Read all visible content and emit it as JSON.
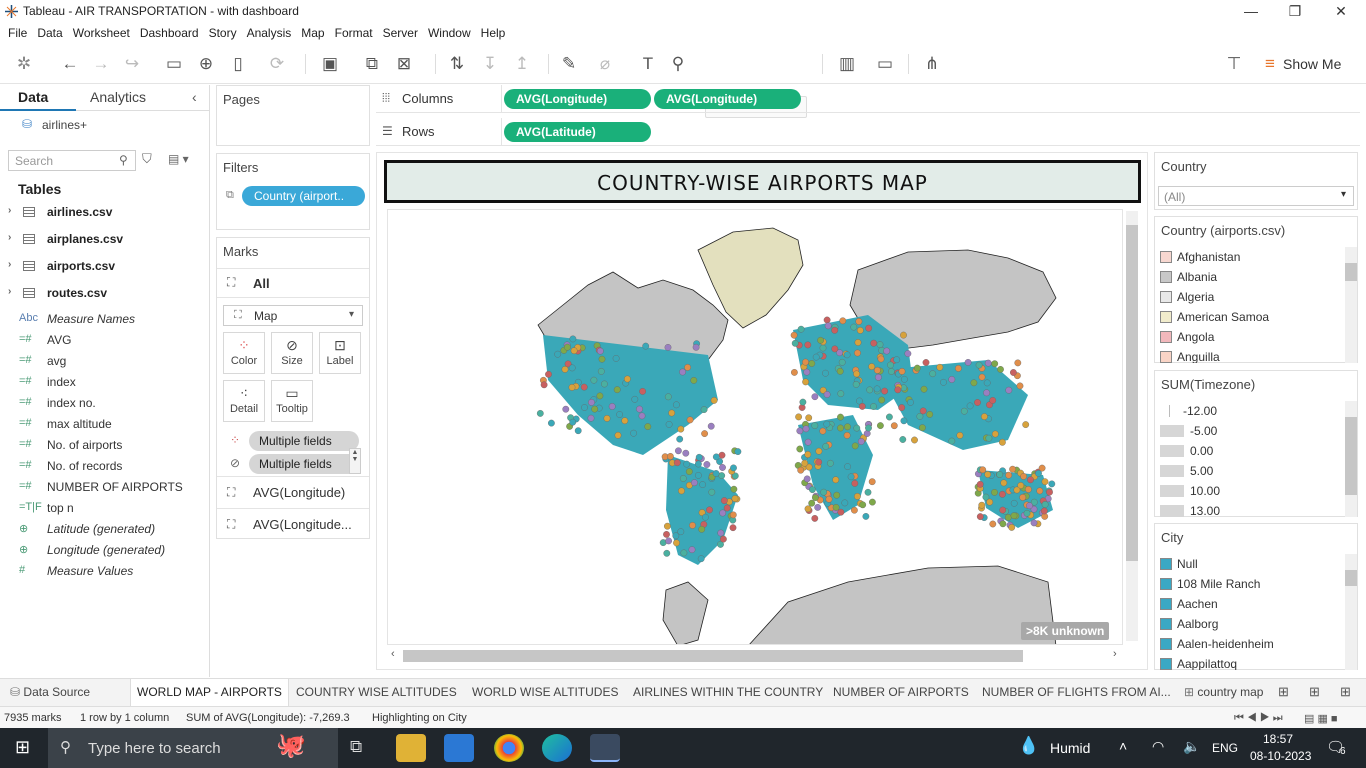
{
  "window": {
    "title": "Tableau - AIR TRANSPORTATION - with dashboard",
    "minimize": "—",
    "restore": "❐",
    "close": "✕"
  },
  "menu": [
    "File",
    "Data",
    "Worksheet",
    "Dashboard",
    "Story",
    "Analysis",
    "Map",
    "Format",
    "Server",
    "Window",
    "Help"
  ],
  "toolbar": {
    "show_me": "Show Me"
  },
  "left_pane": {
    "tabs": [
      "Data",
      "Analytics"
    ],
    "datasource": "airlines+",
    "search_placeholder": "Search",
    "tables_header": "Tables",
    "tables": [
      "airlines.csv",
      "airplanes.csv",
      "airports.csv",
      "routes.csv"
    ],
    "fields": [
      {
        "icon": "Abc",
        "label": "Measure Names",
        "italic": true
      },
      {
        "icon": "=#",
        "label": "AVG",
        "italic": false
      },
      {
        "icon": "=#",
        "label": "avg",
        "italic": false
      },
      {
        "icon": "=#",
        "label": "index",
        "italic": false
      },
      {
        "icon": "=#",
        "label": "index no.",
        "italic": false
      },
      {
        "icon": "=#",
        "label": "max altitude",
        "italic": false
      },
      {
        "icon": "=#",
        "label": "No. of airports",
        "italic": false
      },
      {
        "icon": "=#",
        "label": "No. of records",
        "italic": false
      },
      {
        "icon": "=#",
        "label": "NUMBER OF AIRPORTS",
        "italic": false
      },
      {
        "icon": "=T|F",
        "label": "top n",
        "italic": false
      },
      {
        "icon": "⊕",
        "label": "Latitude (generated)",
        "italic": true
      },
      {
        "icon": "⊕",
        "label": "Longitude (generated)",
        "italic": true
      },
      {
        "icon": "#",
        "label": "Measure Values",
        "italic": true
      }
    ]
  },
  "shelves": {
    "pages": "Pages",
    "filters": "Filters",
    "filter_pill": "Country (airport..",
    "marks": "Marks",
    "marks_all": "All",
    "mark_type": "Map",
    "mark_buttons": [
      "Color",
      "Size",
      "Label",
      "Detail",
      "Tooltip"
    ],
    "multiple_fields": [
      "Multiple fields",
      "Multiple fields"
    ],
    "mark_layers": [
      "AVG(Longitude)",
      "AVG(Longitude..."
    ],
    "columns_label": "Columns",
    "rows_label": "Rows",
    "columns_pills": [
      "AVG(Longitude)",
      "AVG(Longitude)"
    ],
    "rows_pills": [
      "AVG(Latitude)"
    ]
  },
  "dashboard": {
    "title": "COUNTRY-WISE AIRPORTS MAP",
    "unknown_badge": ">8K unknown"
  },
  "right_pane": {
    "country_header": "Country",
    "country_value": "(All)",
    "country_legend_header": "Country (airports.csv)",
    "country_items": [
      {
        "label": "Afghanistan",
        "color": "#f7d7d0"
      },
      {
        "label": "Albania",
        "color": "#c8c8c8"
      },
      {
        "label": "Algeria",
        "color": "#e8e8e8"
      },
      {
        "label": "American Samoa",
        "color": "#f1eccc"
      },
      {
        "label": "Angola",
        "color": "#f2b8bc"
      },
      {
        "label": "Anguilla",
        "color": "#f9d4c6"
      }
    ],
    "tz_header": "SUM(Timezone)",
    "tz_items": [
      "-12.00",
      "-5.00",
      "0.00",
      "5.00",
      "10.00",
      "13.00"
    ],
    "city_header": "City",
    "city_items": [
      "Null",
      "108 Mile Ranch",
      "Aachen",
      "Aalborg",
      "Aalen-heidenheim",
      "Aappilattoq"
    ],
    "city_color": "#3aa8c4"
  },
  "sheet_tabs": [
    "Data Source",
    "WORLD MAP - AIRPORTS",
    "COUNTRY WISE ALTITUDES",
    "WORLD WISE ALTITUDES",
    "AIRLINES WITHIN THE COUNTRY",
    "NUMBER OF AIRPORTS",
    "NUMBER OF FLIGHTS FROM AI...",
    "country map"
  ],
  "status": {
    "marks": "7935 marks",
    "layout": "1 row by 1 column",
    "sum": "SUM of AVG(Longitude): -7,269.3",
    "highlight": "Highlighting on City"
  },
  "taskbar": {
    "search": "Type here to search",
    "weather": "Humid",
    "lang": "ENG",
    "time": "18:57",
    "date": "08-10-2023",
    "notif": "6"
  }
}
